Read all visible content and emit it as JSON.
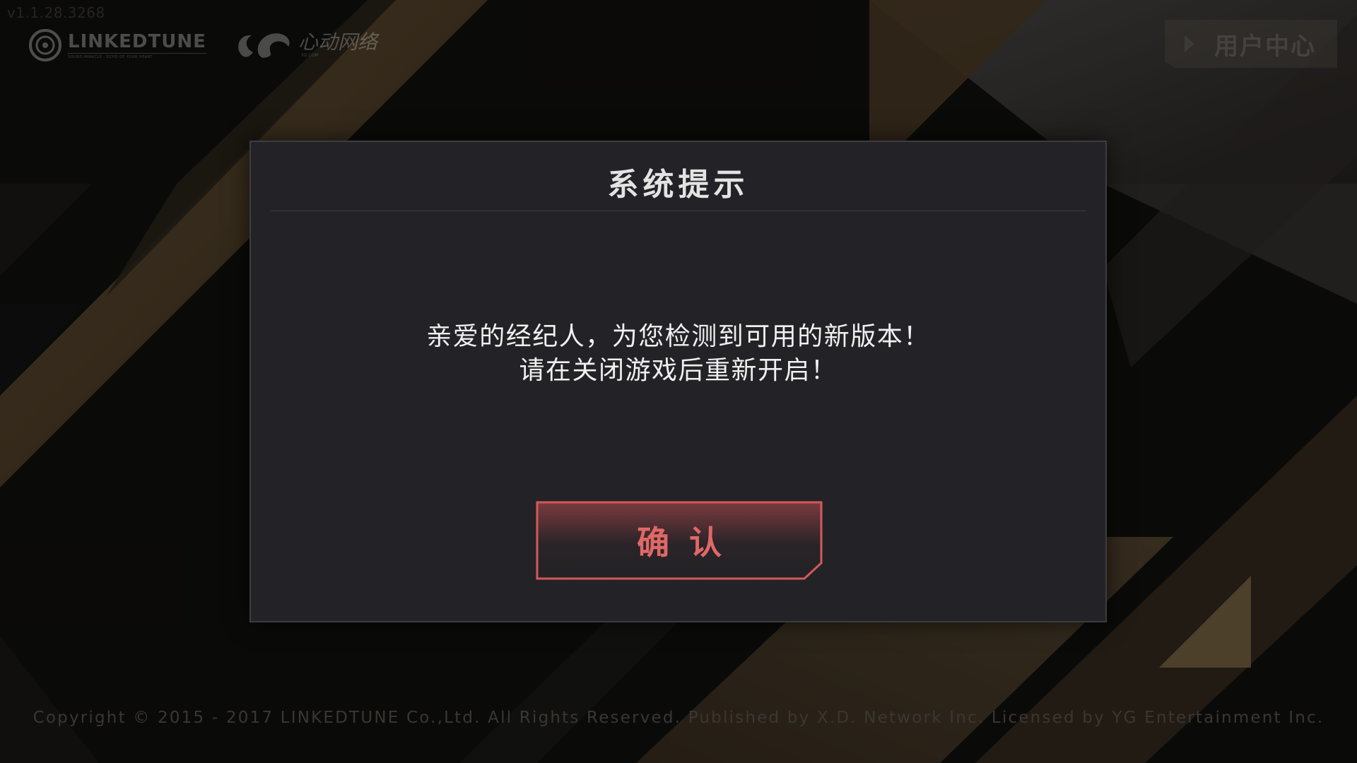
{
  "version": "v1.1.28.3268",
  "header": {
    "linkedtune_logo": {
      "name": "LINKEDTUNE",
      "tagline": "SOUND MIRACLE · ECHO OF YOUR HEART"
    },
    "xd_logo": {
      "name": "心动网络",
      "sub": "XD.COM"
    },
    "user_center_label": "用户中心"
  },
  "dialog": {
    "title": "系统提示",
    "message_lines": [
      "亲爱的经纪人，为您检测到可用的新版本！",
      "请在关闭游戏后重新开启！"
    ],
    "confirm_label": "确认"
  },
  "footer": {
    "copyright": "Copyright © 2015 - 2017 LINKEDTUNE Co.,Ltd. All Rights Reserved. Published by X.D. Network Inc. Licensed by YG Entertainment Inc."
  },
  "colors": {
    "background": "#0d0c0b",
    "stripe_gold": "#4a3a24",
    "dialog_bg": "#232226",
    "accent_red": "#e06866",
    "button_border": "#d4595b"
  },
  "icons": {
    "user_center": "play-triangle-icon",
    "linkedtune": "linkedtune-ring-icon",
    "xd": "xd-swirl-icon"
  }
}
